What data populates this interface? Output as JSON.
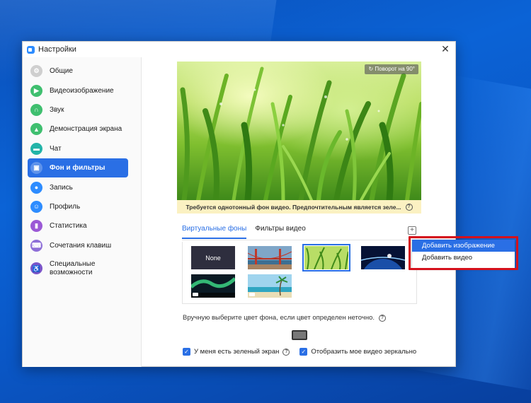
{
  "window": {
    "title": "Настройки"
  },
  "sidebar": {
    "items": [
      {
        "label": "Общие",
        "color": "#cfcfcf",
        "icon": "gear-icon",
        "glyph": "⚙"
      },
      {
        "label": "Видеоизображение",
        "color": "#3fbf6f",
        "icon": "video-camera-icon",
        "glyph": "▶"
      },
      {
        "label": "Звук",
        "color": "#3fbf6f",
        "icon": "headphones-icon",
        "glyph": "∩"
      },
      {
        "label": "Демонстрация экрана",
        "color": "#3fbf6f",
        "icon": "screen-share-icon",
        "glyph": "▲"
      },
      {
        "label": "Чат",
        "color": "#23b4a8",
        "icon": "chat-bubble-icon",
        "glyph": "▬"
      },
      {
        "label": "Фон и фильтры",
        "color": "#ffffff",
        "icon": "background-filter-icon",
        "glyph": "▣",
        "active": true
      },
      {
        "label": "Запись",
        "color": "#2d8cff",
        "icon": "record-icon",
        "glyph": "●"
      },
      {
        "label": "Профиль",
        "color": "#2d8cff",
        "icon": "profile-icon",
        "glyph": "☺"
      },
      {
        "label": "Статистика",
        "color": "#9b59d6",
        "icon": "statistics-icon",
        "glyph": "▮"
      },
      {
        "label": "Сочетания клавиш",
        "color": "#8e6fd8",
        "icon": "keyboard-icon",
        "glyph": "⌨"
      },
      {
        "label": "Специальные возможности",
        "color": "#7a55c9",
        "icon": "accessibility-icon",
        "glyph": "♿"
      }
    ]
  },
  "preview": {
    "rotate_label": "Поворот на 90°",
    "notice": "Требуется однотонный фон видео. Предпочтительным является зеле..."
  },
  "tabs": [
    {
      "label": "Виртуальные фоны",
      "active": true
    },
    {
      "label": "Фильтры видео",
      "active": false
    }
  ],
  "gallery": {
    "items": [
      {
        "kind": "none",
        "label": "None"
      },
      {
        "kind": "bridge"
      },
      {
        "kind": "grass",
        "selected": true
      },
      {
        "kind": "earth"
      },
      {
        "kind": "aurora",
        "video": true
      },
      {
        "kind": "beach",
        "video": true
      }
    ]
  },
  "settings": {
    "manual_color_text": "Вручную выберите цвет фона, если цвет определен неточно.",
    "green_screen_label": "У меня есть зеленый экран",
    "mirror_label": "Отобразить мое видео зеркально"
  },
  "dropdown": {
    "items": [
      {
        "label": "Добавить изображение",
        "highlighted": true
      },
      {
        "label": "Добавить видео",
        "highlighted": false
      }
    ]
  },
  "colors": {
    "accent": "#2a6fe5",
    "highlight_frame": "#d5111c",
    "notice_bg": "#fbf1c2"
  }
}
